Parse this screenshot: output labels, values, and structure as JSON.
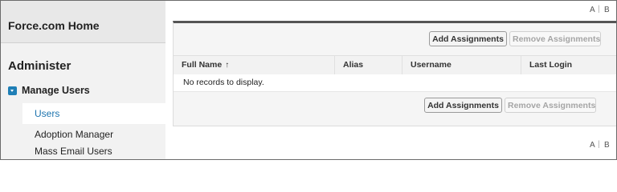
{
  "sidebar": {
    "home_link": "Force.com Home",
    "section_title": "Administer",
    "group_label": "Manage Users",
    "items": [
      {
        "label": "Users"
      },
      {
        "label": "Adoption Manager"
      },
      {
        "label": "Mass Email Users"
      }
    ]
  },
  "main": {
    "alpha_top": {
      "a": "A",
      "sep": "|",
      "b": "B"
    },
    "alpha_bottom": {
      "a": "A",
      "sep": "|",
      "b": "B"
    },
    "buttons_top": {
      "add": "Add Assignments",
      "remove": "Remove Assignments"
    },
    "buttons_bottom": {
      "add": "Add Assignments",
      "remove": "Remove Assignments"
    },
    "table": {
      "columns": [
        "Full Name",
        "Alias",
        "Username",
        "Last Login"
      ],
      "sort_indicator": "↑",
      "empty_message": "No records to display."
    }
  },
  "colors": {
    "link_blue": "#1d74ae",
    "icon_blue": "#1f7fb6",
    "panel_border": "#555555"
  }
}
